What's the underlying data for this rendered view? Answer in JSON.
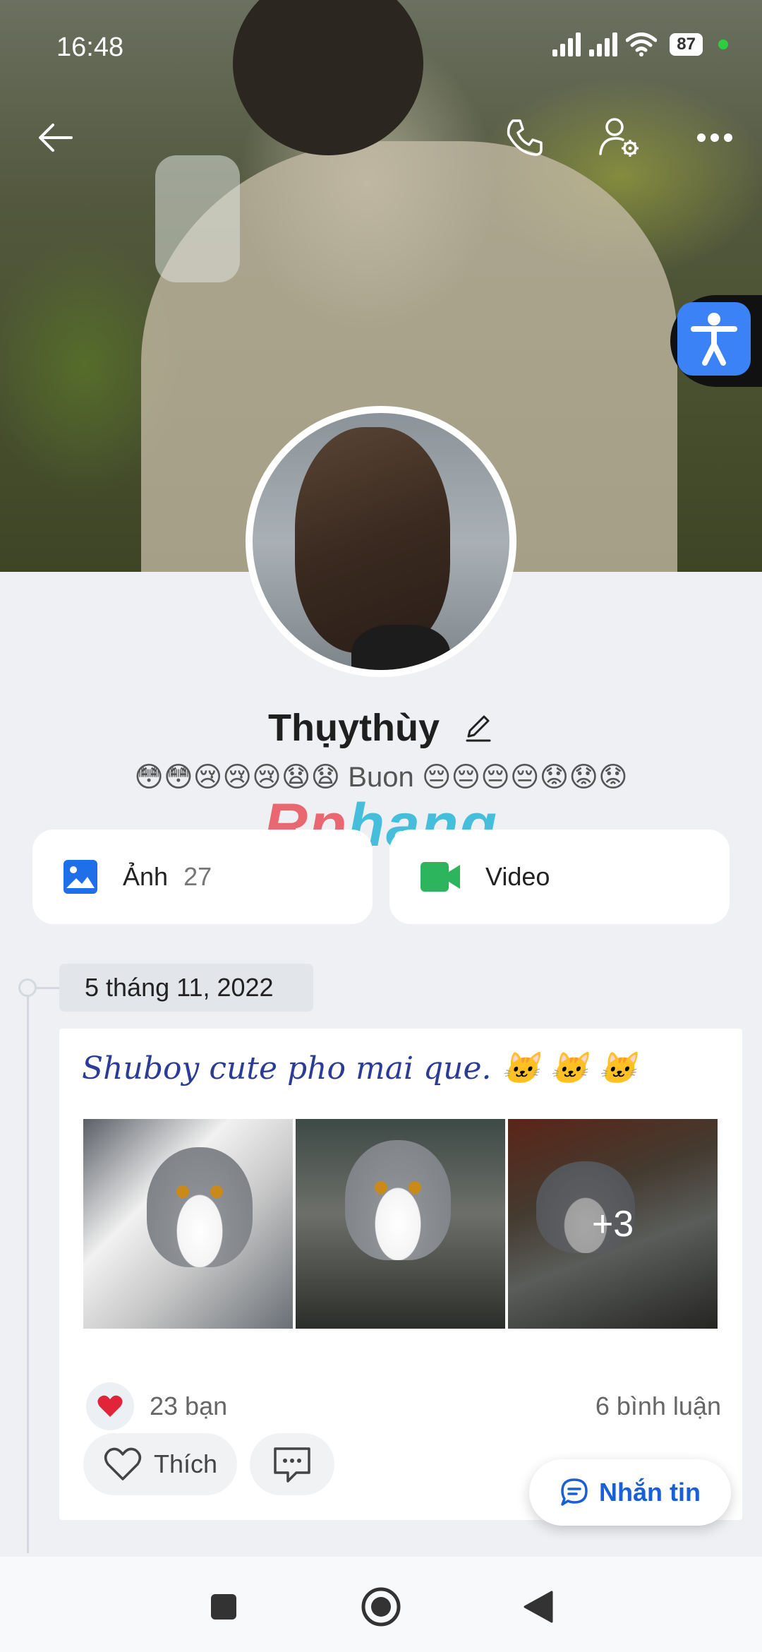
{
  "status_bar": {
    "time": "16:48",
    "battery": "87"
  },
  "profile": {
    "name": "Thụythùy",
    "status_text": "😳😳😢😢😢😧😧 Buon 😔😔😔😔😟😟😟"
  },
  "watermark": {
    "part1": "Rp",
    "part2": "hang"
  },
  "media": {
    "photos_label": "Ảnh",
    "photos_count": "27",
    "video_label": "Video"
  },
  "timeline": {
    "date": "5 tháng 11, 2022",
    "post": {
      "caption": "Shuboy cute pho mai que. 🐱 🐱 🐱",
      "more_images": "+3",
      "reactions": "23 bạn",
      "comments": "6 bình luận",
      "like_label": "Thích"
    }
  },
  "chat_button": {
    "label": "Nhắn tin"
  },
  "colors": {
    "accent": "#1a5fd6",
    "photo_icon": "#1e6fe8",
    "video_icon": "#2db55d",
    "heart": "#e0243a"
  },
  "icons": [
    "back-arrow-icon",
    "phone-icon",
    "user-settings-icon",
    "more-icon",
    "accessibility-icon",
    "edit-icon",
    "image-icon",
    "video-camera-icon",
    "heart-icon",
    "comment-icon",
    "chat-icon",
    "nav-square-icon",
    "nav-home-icon",
    "nav-back-icon"
  ]
}
